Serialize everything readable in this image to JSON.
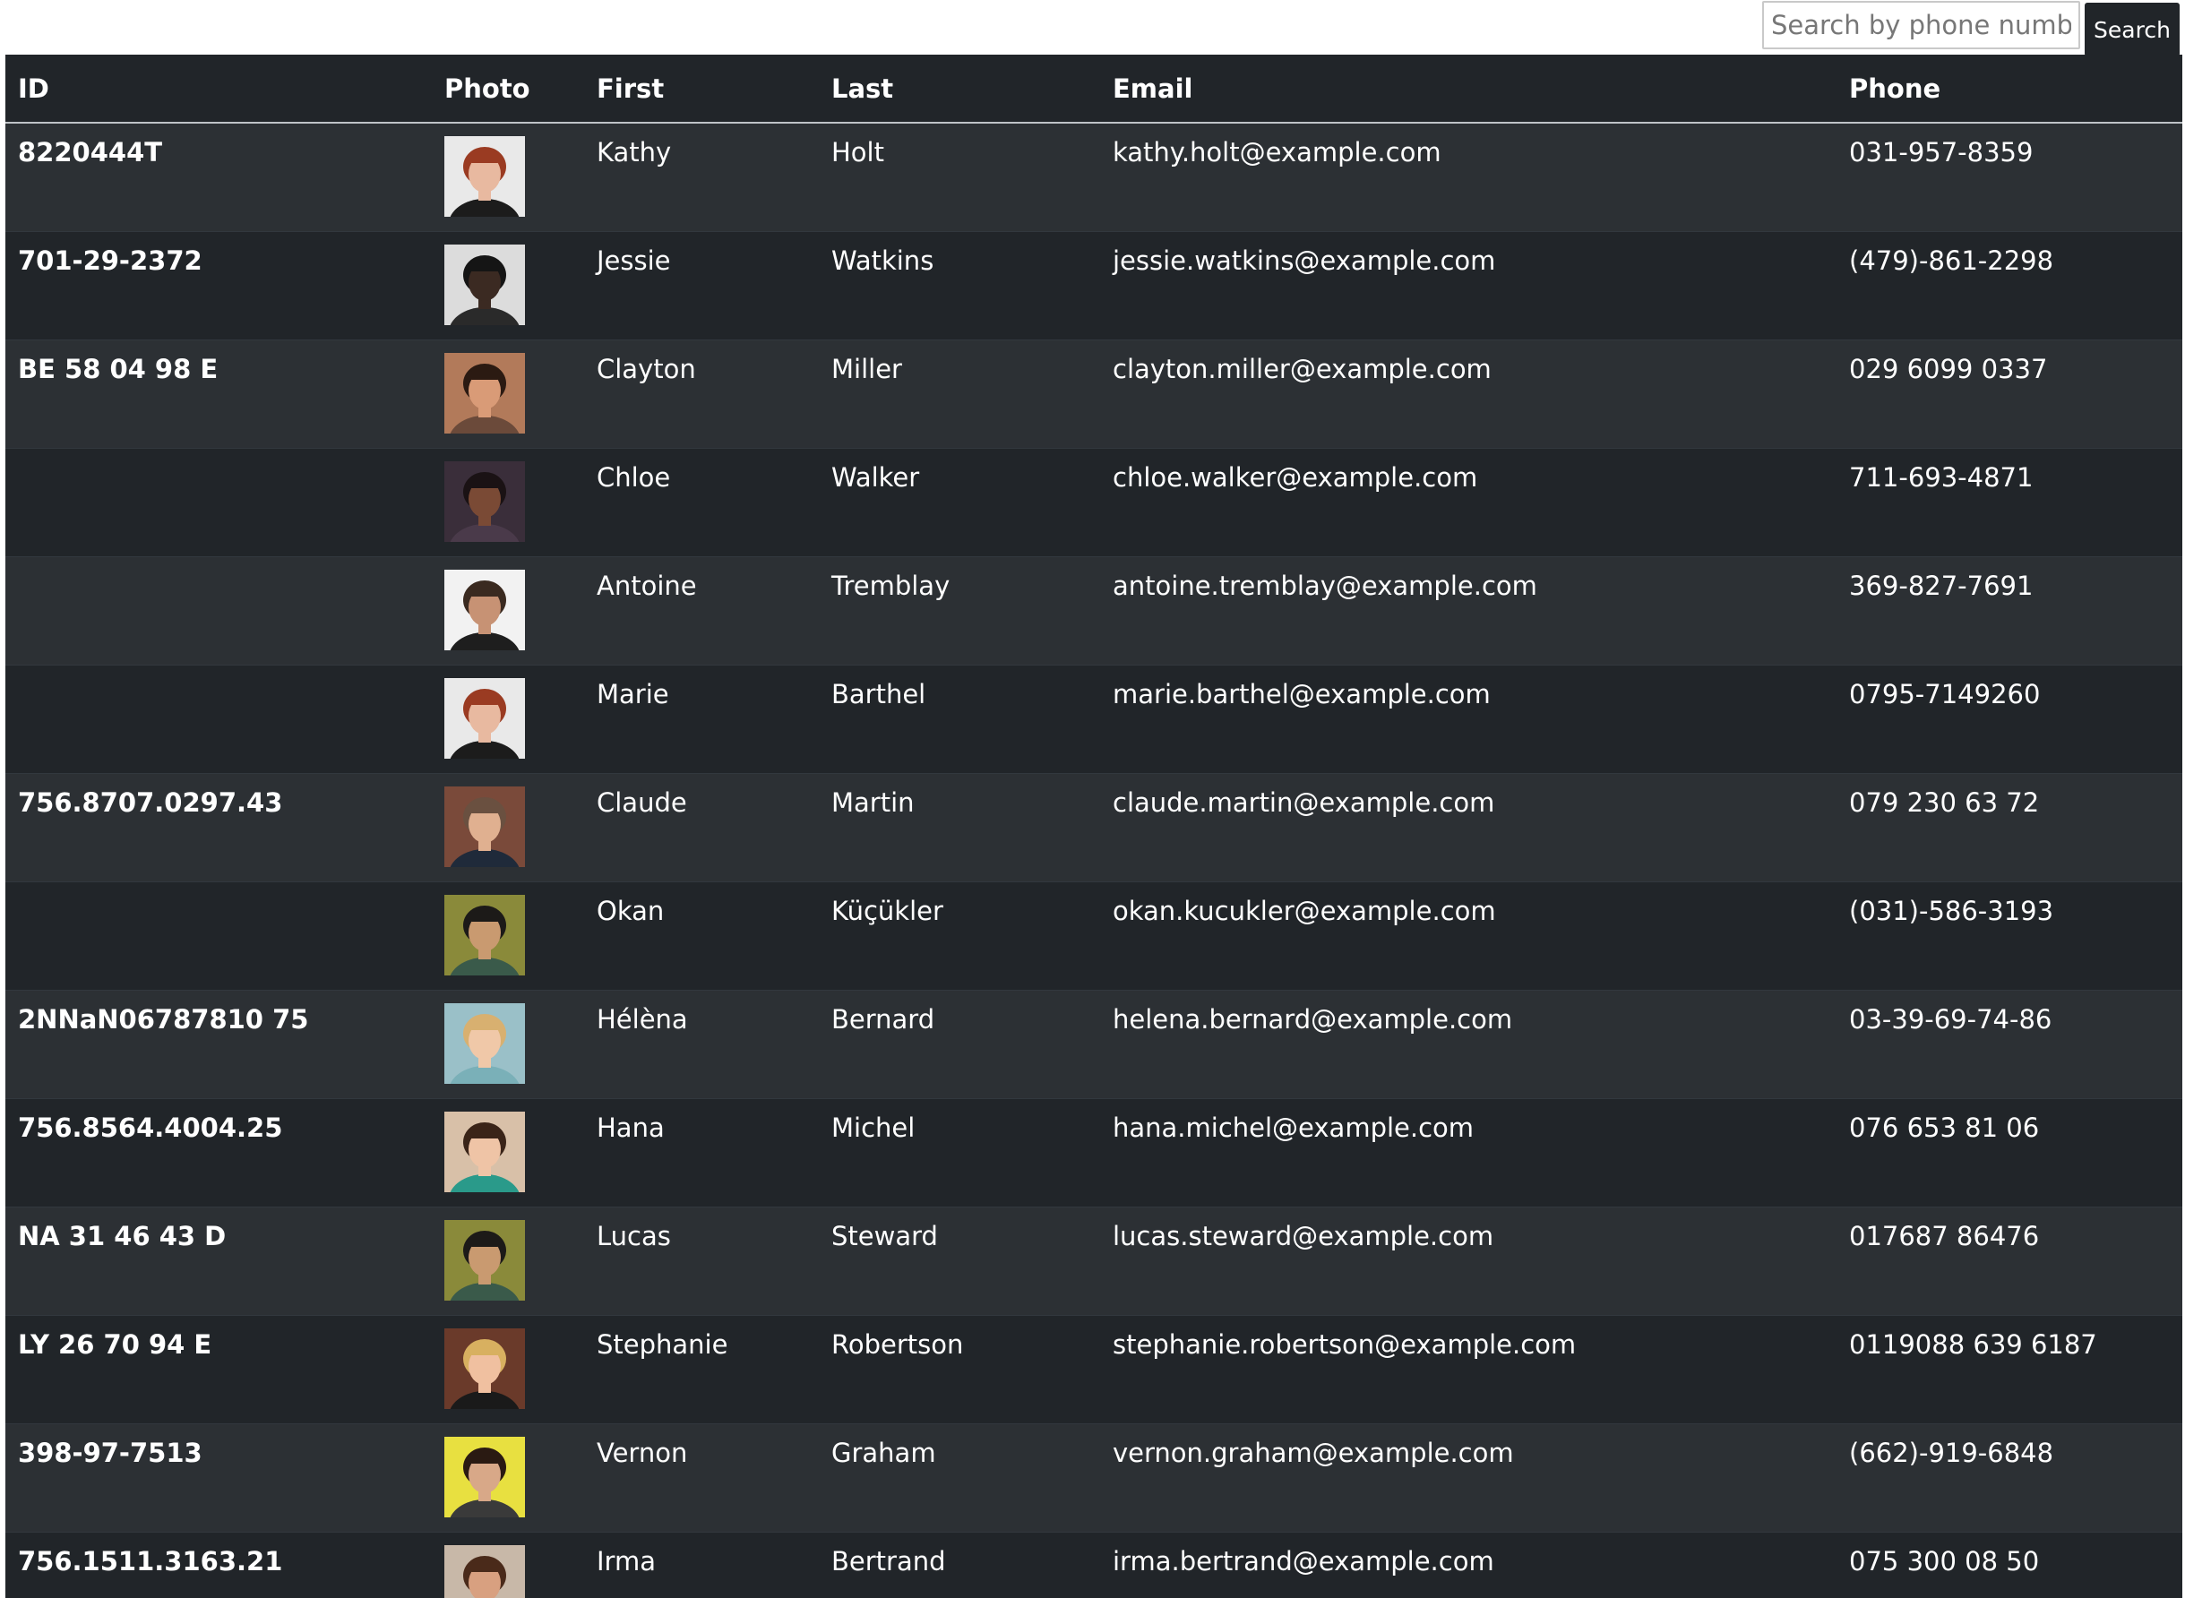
{
  "search": {
    "placeholder": "Search by phone number",
    "value": "",
    "button_label": "Search"
  },
  "table": {
    "columns": [
      "ID",
      "Photo",
      "First",
      "Last",
      "Email",
      "Phone"
    ],
    "rows": [
      {
        "id": "8220444T",
        "first": "Kathy",
        "last": "Holt",
        "email": "kathy.holt@example.com",
        "phone": "031-957-8359",
        "photo": {
          "bg": "#e9e9e9",
          "skin": "#e8b9a0",
          "hair": "#9a3b22",
          "shirt": "#1c1c1c"
        }
      },
      {
        "id": "701-29-2372",
        "first": "Jessie",
        "last": "Watkins",
        "email": "jessie.watkins@example.com",
        "phone": "(479)-861-2298",
        "photo": {
          "bg": "#dcdcdc",
          "skin": "#3b2a22",
          "hair": "#151515",
          "shirt": "#2a2a2a"
        }
      },
      {
        "id": "BE 58 04 98 E",
        "first": "Clayton",
        "last": "Miller",
        "email": "clayton.miller@example.com",
        "phone": "029 6099 0337",
        "photo": {
          "bg": "#b27a5a",
          "skin": "#d99b77",
          "hair": "#2b1a12",
          "shirt": "#6b4a3a"
        }
      },
      {
        "id": "",
        "first": "Chloe",
        "last": "Walker",
        "email": "chloe.walker@example.com",
        "phone": "711-693-4871",
        "photo": {
          "bg": "#3a2e3a",
          "skin": "#7a4a35",
          "hair": "#1a1214",
          "shirt": "#4a3a4a"
        }
      },
      {
        "id": "",
        "first": "Antoine",
        "last": "Tremblay",
        "email": "antoine.tremblay@example.com",
        "phone": "369-827-7691",
        "photo": {
          "bg": "#f2f2f2",
          "skin": "#c79274",
          "hair": "#3a2a20",
          "shirt": "#1e1e1e"
        }
      },
      {
        "id": "",
        "first": "Marie",
        "last": "Barthel",
        "email": "marie.barthel@example.com",
        "phone": "0795-7149260",
        "photo": {
          "bg": "#e9e9e9",
          "skin": "#e8b9a0",
          "hair": "#9a3b22",
          "shirt": "#1c1c1c"
        }
      },
      {
        "id": "756.8707.0297.43",
        "first": "Claude",
        "last": "Martin",
        "email": "claude.martin@example.com",
        "phone": "079 230 63 72",
        "photo": {
          "bg": "#7a4a3a",
          "skin": "#e0b090",
          "hair": "#6a5040",
          "shirt": "#1f2a3a"
        }
      },
      {
        "id": "",
        "first": "Okan",
        "last": "Küçükler",
        "email": "okan.kucukler@example.com",
        "phone": "(031)-586-3193",
        "photo": {
          "bg": "#8a8a3a",
          "skin": "#c99a70",
          "hair": "#1c1a18",
          "shirt": "#3a5a4a"
        }
      },
      {
        "id": "2NNaN06787810 75",
        "first": "Hélèna",
        "last": "Bernard",
        "email": "helena.bernard@example.com",
        "phone": "03-39-69-74-86",
        "photo": {
          "bg": "#9ac0c8",
          "skin": "#f0c8a8",
          "hair": "#d8b070",
          "shirt": "#7ab0b8"
        }
      },
      {
        "id": "756.8564.4004.25",
        "first": "Hana",
        "last": "Michel",
        "email": "hana.michel@example.com",
        "phone": "076 653 81 06",
        "photo": {
          "bg": "#d8c0a8",
          "skin": "#efc4a6",
          "hair": "#3a2418",
          "shirt": "#2a9a8a"
        }
      },
      {
        "id": "NA 31 46 43 D",
        "first": "Lucas",
        "last": "Steward",
        "email": "lucas.steward@example.com",
        "phone": "017687 86476",
        "photo": {
          "bg": "#8a8a3a",
          "skin": "#c99a70",
          "hair": "#1c1a18",
          "shirt": "#3a5a4a"
        }
      },
      {
        "id": "LY 26 70 94 E",
        "first": "Stephanie",
        "last": "Robertson",
        "email": "stephanie.robertson@example.com",
        "phone": "0119088 639 6187",
        "photo": {
          "bg": "#6a3a2a",
          "skin": "#f0c0a0",
          "hair": "#d8b060",
          "shirt": "#1a1a1a"
        }
      },
      {
        "id": "398-97-7513",
        "first": "Vernon",
        "last": "Graham",
        "email": "vernon.graham@example.com",
        "phone": "(662)-919-6848",
        "photo": {
          "bg": "#e8e040",
          "skin": "#d8a888",
          "hair": "#2a1a12",
          "shirt": "#3a3a3a"
        }
      },
      {
        "id": "756.1511.3163.21",
        "first": "Irma",
        "last": "Bertrand",
        "email": "irma.bertrand@example.com",
        "phone": "075 300 08 50",
        "photo": {
          "bg": "#c8b8a8",
          "skin": "#d8a080",
          "hair": "#4a2a1a",
          "shirt": "#5a4a4a"
        }
      }
    ]
  }
}
